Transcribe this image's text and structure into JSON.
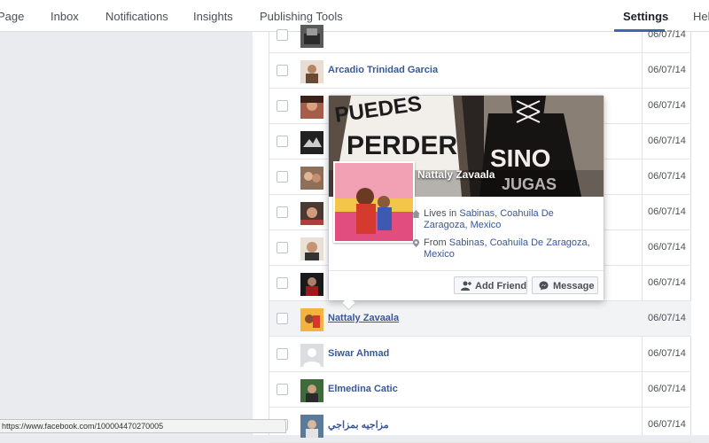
{
  "nav": {
    "items": [
      "Page",
      "Inbox",
      "Notifications",
      "Insights",
      "Publishing Tools",
      "Settings",
      "Help"
    ],
    "active": "Settings",
    "accent": "#4267b2"
  },
  "rows": [
    {
      "name": "",
      "date": "06/07/14"
    },
    {
      "name": "Arcadio Trinidad Garcia",
      "date": "06/07/14"
    },
    {
      "name": "",
      "date": "06/07/14"
    },
    {
      "name": "",
      "date": "06/07/14"
    },
    {
      "name": "",
      "date": "06/07/14"
    },
    {
      "name": "",
      "date": "06/07/14"
    },
    {
      "name": "",
      "date": "06/07/14"
    },
    {
      "name": "",
      "date": "06/07/14"
    },
    {
      "name": "Nattaly Zavaala",
      "date": "06/07/14"
    },
    {
      "name": "Siwar Ahmad",
      "date": "06/07/14"
    },
    {
      "name": "Elmedina Catic",
      "date": "06/07/14"
    },
    {
      "name": "مزاجيه بمزاجي",
      "date": "06/07/14"
    }
  ],
  "hovercard": {
    "name": "Nattaly Zavaala",
    "cover_text": "PUEDES PERDER SINO JUGAS",
    "lives_in_prefix": "Lives in",
    "lives_in_place": "Sabinas, Coahuila De Zaragoza, Mexico",
    "from_prefix": "From",
    "from_place": "Sabinas, Coahuila De Zaragoza, Mexico",
    "add_friend_label": "Add Friend",
    "message_label": "Message",
    "icons": [
      "home-icon",
      "location-pin-icon",
      "add-friend-icon",
      "messenger-icon"
    ]
  },
  "status_bar": {
    "url": "https://www.facebook.com/100004470270005"
  }
}
